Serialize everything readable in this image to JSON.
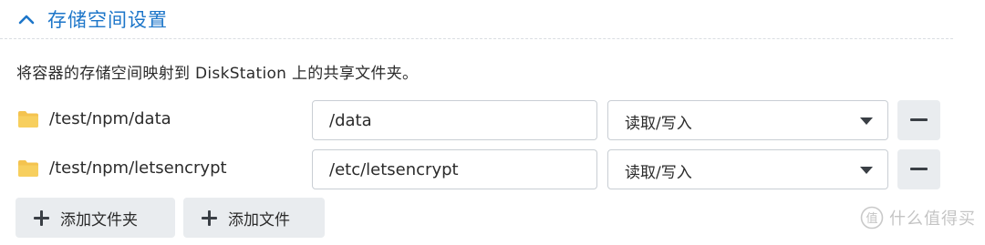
{
  "section": {
    "title": "存储空间设置",
    "icon": "chevron-up-icon"
  },
  "description": "将容器的存储空间映射到 DiskStation 上的共享文件夹。",
  "mappings": [
    {
      "folder_icon": "folder-icon",
      "folder_path": "/test/npm/data",
      "mount_path": "/data",
      "permission": "读取/写入"
    },
    {
      "folder_icon": "folder-icon",
      "folder_path": "/test/npm/letsencrypt",
      "mount_path": "/etc/letsencrypt",
      "permission": "读取/写入"
    }
  ],
  "actions": {
    "add_folder_label": "添加文件夹",
    "add_file_label": "添加文件"
  },
  "watermark": {
    "text": "什么值得买",
    "logo": "值"
  },
  "colors": {
    "accent": "#1d76c9",
    "folder": "#f4c34f",
    "button_bg": "#e9ecef",
    "border": "#c9ced4"
  }
}
